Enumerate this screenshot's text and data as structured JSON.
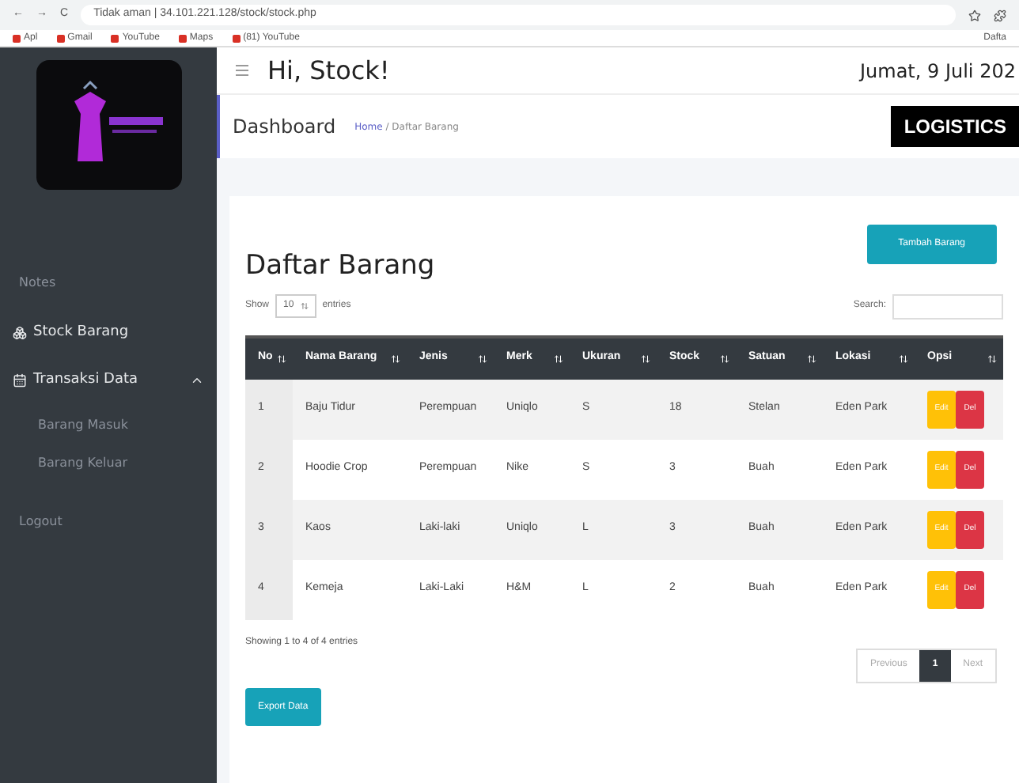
{
  "browser": {
    "nav": [
      "←",
      "→",
      "C"
    ],
    "address": "Tidak aman | 34.101.221.128/stock/stock.php",
    "bookmarks": [
      "Apl",
      "Gmail",
      "YouTube",
      "Maps",
      "(81) YouTube"
    ],
    "other_bookmarks": "Dafta"
  },
  "sidebar": {
    "items": [
      {
        "kind": "heading",
        "label": "Notes"
      },
      {
        "kind": "link",
        "label": "Stock Barang"
      },
      {
        "kind": "group",
        "label": "Transaksi Data",
        "expanded": true,
        "children": [
          {
            "label": "Barang Masuk"
          },
          {
            "label": "Barang Keluar"
          }
        ]
      },
      {
        "kind": "heading",
        "label": "Logout"
      }
    ]
  },
  "topbar": {
    "greeting": "Hi, Stock!",
    "date": "Jumat, 9 Juli 202"
  },
  "header": {
    "title": "Dashboard",
    "breadcrumb": {
      "link": "Home",
      "rest": "/ Daftar Barang"
    },
    "logo": "LOGISTICS"
  },
  "card": {
    "title": "Daftar Barang",
    "add_button": "Tambah Barang",
    "length": {
      "before": "Show",
      "value": "10",
      "after": "entries"
    },
    "search_label": "Search:",
    "table": {
      "columns": [
        "No",
        "Nama Barang",
        "Jenis",
        "Merk",
        "Ukuran",
        "Stock",
        "Satuan",
        "Lokasi",
        "Opsi"
      ],
      "rows": [
        {
          "cells": [
            "1",
            "Baju Tidur",
            "Perempuan",
            "Uniqlo",
            "S",
            "18",
            "Stelan",
            "Eden Park"
          ],
          "edit": "Edit",
          "delete": "Del"
        },
        {
          "cells": [
            "2",
            "Hoodie Crop",
            "Perempuan",
            "Nike",
            "S",
            "3",
            "Buah",
            "Eden Park"
          ],
          "edit": "Edit",
          "delete": "Del"
        },
        {
          "cells": [
            "3",
            "Kaos",
            "Laki-laki",
            "Uniqlo",
            "L",
            "3",
            "Buah",
            "Eden Park"
          ],
          "edit": "Edit",
          "delete": "Del"
        },
        {
          "cells": [
            "4",
            "Kemeja",
            "Laki-Laki",
            "H&M",
            "L",
            "2",
            "Buah",
            "Eden Park"
          ],
          "edit": "Edit",
          "delete": "Del"
        }
      ]
    },
    "info": "Showing 1 to 4 of 4 entries",
    "pagination": [
      {
        "label": "Previous",
        "selected": false
      },
      {
        "label": "1",
        "selected": true
      },
      {
        "label": "Next",
        "selected": false
      }
    ],
    "export_button": "Export Data"
  }
}
